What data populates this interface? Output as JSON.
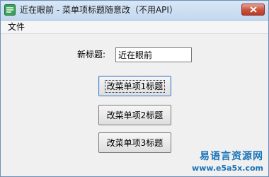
{
  "window": {
    "title": "近在眼前 - 菜单项标题随意改（不用API）"
  },
  "menu": {
    "file_label": "文件"
  },
  "form": {
    "new_title_label": "新标题:",
    "new_title_value": "近在眼前"
  },
  "buttons": {
    "item1_label": "改菜单项1标题",
    "item2_label": "改菜单项2标题",
    "item3_label": "改菜单项3标题"
  },
  "watermark": {
    "chinese": "易语言资源网",
    "url": "www.e5a5x.com"
  },
  "colors": {
    "watermark": "#1a73b8",
    "close_button": "#c8523c"
  },
  "icons": {
    "app": "app-window-icon",
    "close": "close-icon"
  }
}
